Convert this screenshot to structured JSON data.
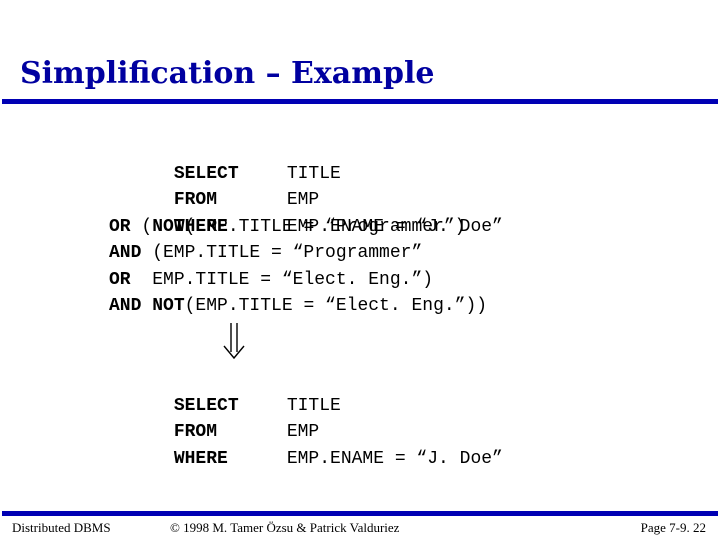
{
  "slide": {
    "title": "Simplification – Example",
    "colors": {
      "title": "#0000a0",
      "rule": "#0000b4",
      "text": "#000000",
      "background": "#ffffff"
    }
  },
  "original_query": {
    "lines": [
      {
        "keyword": "SELECT",
        "text": "TITLE"
      },
      {
        "keyword": "FROM",
        "text": "EMP"
      },
      {
        "keyword": "WHERE",
        "text": "EMP.ENAME = “J. Doe”"
      },
      {
        "keyword": "OR",
        "prefix": " (",
        "keyword2": "NOT",
        "text": "(EMP.TITLE = “Programmer”)"
      },
      {
        "keyword": "AND",
        "text": " (EMP.TITLE = “Programmer”"
      },
      {
        "keyword": "OR",
        "text": "  EMP.TITLE = “Elect. Eng.”)"
      },
      {
        "keyword": "AND",
        "keyword2": "NOT",
        "text": "(EMP.TITLE = “Elect. Eng.”))"
      }
    ]
  },
  "transform_arrow": {
    "icon": "double-down-arrow-icon",
    "glyph": "⇓"
  },
  "simplified_query": {
    "lines": [
      {
        "keyword": "SELECT",
        "text": "TITLE"
      },
      {
        "keyword": "FROM",
        "text": "EMP"
      },
      {
        "keyword": "WHERE",
        "text": "EMP.ENAME = “J. Doe”"
      }
    ]
  },
  "footer": {
    "left": "Distributed DBMS",
    "center": "© 1998 M. Tamer Özsu & Patrick Valduriez",
    "right": "Page 7-9. 22"
  }
}
